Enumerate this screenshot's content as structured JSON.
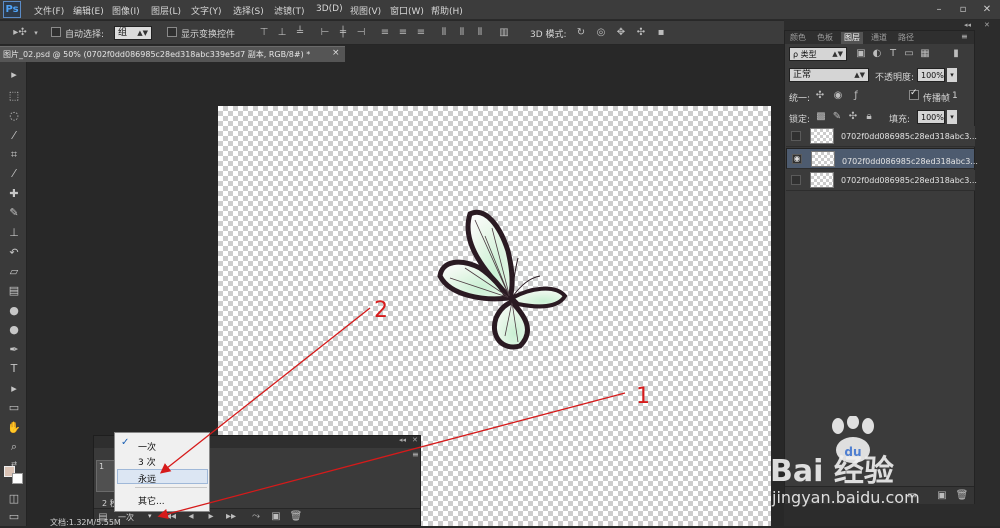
{
  "app": {
    "logo": "Ps"
  },
  "menu": [
    "文件(F)",
    "编辑(E)",
    "图像(I)",
    "图层(L)",
    "文字(Y)",
    "选择(S)",
    "滤镜(T)",
    "3D(D)",
    "视图(V)",
    "窗口(W)",
    "帮助(H)"
  ],
  "window_controls": [
    "–",
    "▫",
    "✕"
  ],
  "options_bar": {
    "auto_select_label": "自动选择:",
    "auto_select_value": "组",
    "show_transform_label": "显示变换控件",
    "mode_3d_label": "3D 模式:"
  },
  "document_tab": {
    "title": "图片_02.psd @ 50% (0702f0dd086985c28ed318abc339e5d7 副本, RGB/8#) *",
    "close": "×"
  },
  "layers_panel": {
    "tabs": [
      "颜色",
      "色板",
      "图层",
      "通道",
      "路径"
    ],
    "active_tab": "图层",
    "filter_kind": "ρ 类型",
    "blend_mode": "正常",
    "opacity_label": "不透明度:",
    "opacity_value": "100%",
    "unify_label": "统一:",
    "propagate_label": "传播帧",
    "propagate_value": "1",
    "lock_label": "锁定:",
    "fill_label": "填充:",
    "fill_value": "100%",
    "layers": [
      {
        "name": "0702f0dd086985c28ed318abc3...",
        "visible": false,
        "selected": false
      },
      {
        "name": "0702f0dd086985c28ed318abc3...",
        "visible": true,
        "selected": true
      },
      {
        "name": "0702f0dd086985c28ed318abc3...",
        "visible": false,
        "selected": false
      }
    ]
  },
  "history_panel": {
    "frame1_number": "1",
    "frame2_label": "2 秒",
    "loop_value": "一次",
    "status": "文档:1.32M/5.55M"
  },
  "loop_popup": {
    "items": [
      "一次",
      "3 次",
      "永远",
      "其它..."
    ],
    "checked": "一次",
    "highlighted": "永远"
  },
  "annotations": {
    "label_1": "1",
    "label_2": "2"
  },
  "watermark": {
    "brand": "Bai 经验",
    "url": "jingyan.baidu.com"
  },
  "colors": {
    "annotation_red": "#d61a1a",
    "selection_blue": "#4d5b6f"
  }
}
